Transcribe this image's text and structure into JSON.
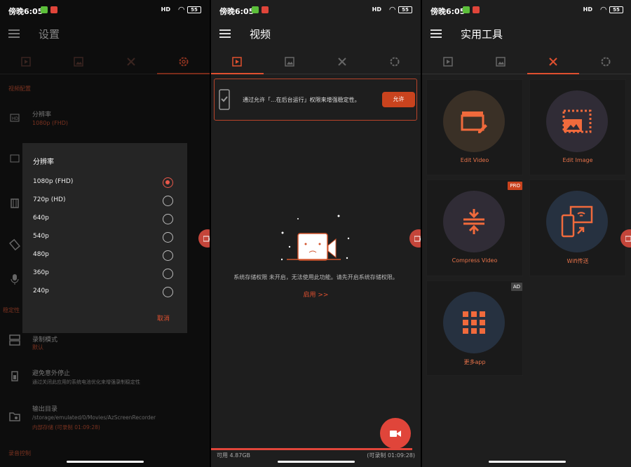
{
  "status_bar": {
    "time": "傍晚6:05",
    "signal": "HD",
    "battery": "55"
  },
  "accent": "#e0502f",
  "settings": {
    "title": "设置",
    "section_video": "视频配置",
    "resolution_label": "分辨率",
    "resolution_value": "1080p (FHD)",
    "section_stability": "稳定性",
    "record_mode_label": "录制模式",
    "record_mode_value": "默认",
    "avoid_stop_label": "避免意外停止",
    "avoid_stop_desc": "通过关闭此应用的系统电池优化来增强录制稳定性",
    "output_label": "输出目录",
    "output_path": "/storage/emulated/0/Movies/AzScreenRecorder",
    "output_storage": "内部存储 (可录制 01:09:28)",
    "section_audio": "录音控制",
    "dialog": {
      "title": "分辨率",
      "options": [
        "1080p (FHD)",
        "720p (HD)",
        "640p",
        "540p",
        "480p",
        "360p",
        "240p"
      ],
      "selected": "1080p (FHD)",
      "cancel": "取消"
    }
  },
  "video": {
    "title": "视频",
    "banner_text": "通过允许「...在后台运行」权限来增强稳定性。",
    "banner_button": "允许",
    "empty_message": "系统存储权限 未开启，无法使用此功能。请先开启系统存储权限。",
    "enable_link": "启用 >>",
    "available": "可用 4.87GB",
    "recordable": "(可录制 01:09:28)"
  },
  "tools": {
    "title": "实用工具",
    "items": [
      {
        "label": "Edit Video",
        "icon": "clapperboard-edit-icon"
      },
      {
        "label": "Edit Image",
        "icon": "image-crop-icon"
      },
      {
        "label": "Compress Video",
        "icon": "compress-icon",
        "badge": "PRO"
      },
      {
        "label": "Wifi传送",
        "icon": "wifi-transfer-icon"
      },
      {
        "label": "更多app",
        "icon": "grid-apps-icon",
        "badge": "AD"
      }
    ]
  }
}
